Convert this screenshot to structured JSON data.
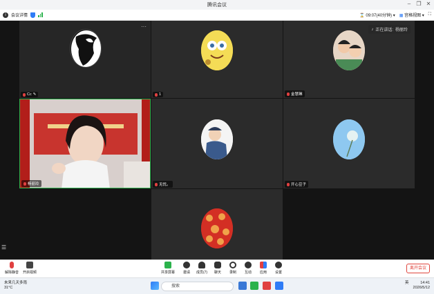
{
  "window": {
    "title": "腾讯会议",
    "minimize": "–",
    "restore": "❐",
    "close": "✕"
  },
  "infobar": {
    "meeting_details": "会议详情",
    "timer": "09:07(40分钟)",
    "view_mode": "宫格视图"
  },
  "speaking": {
    "label": "正在讲话:",
    "name": "杨丽玲"
  },
  "participants": [
    {
      "name": "Cc",
      "avatar": "face-bw",
      "accent": "#ffffff"
    },
    {
      "name": "1",
      "avatar": "cartoon-yellow",
      "accent": "#f2d233"
    },
    {
      "name": "金慧琳",
      "avatar": "children-photo",
      "accent": "#d8b9a3"
    },
    {
      "name": "杨丽玲",
      "avatar": "camera",
      "accent": "#2bb24c"
    },
    {
      "name": "无忧。",
      "avatar": "cartoon-blue",
      "accent": "#3a5a8c"
    },
    {
      "name": "开心豆子",
      "avatar": "dandelion-sky",
      "accent": "#8ec8f0"
    },
    {
      "name": "",
      "avatar": "red-lantern",
      "accent": "#c8281e"
    }
  ],
  "toolbar": {
    "unmute": "解除静音",
    "start_video": "开启视频",
    "share_screen": "共享屏幕",
    "invite": "邀请",
    "members": "成员(7)",
    "chat": "聊天",
    "record": "录制",
    "reactions": "互动",
    "apps": "应用",
    "settings": "设置",
    "leave": "离开会议"
  },
  "taskbar": {
    "weather_title": "未来几天多雨",
    "temperature": "31°C",
    "search": "搜索",
    "ime": "英",
    "time": "14:41",
    "date": "2026/5/12"
  }
}
